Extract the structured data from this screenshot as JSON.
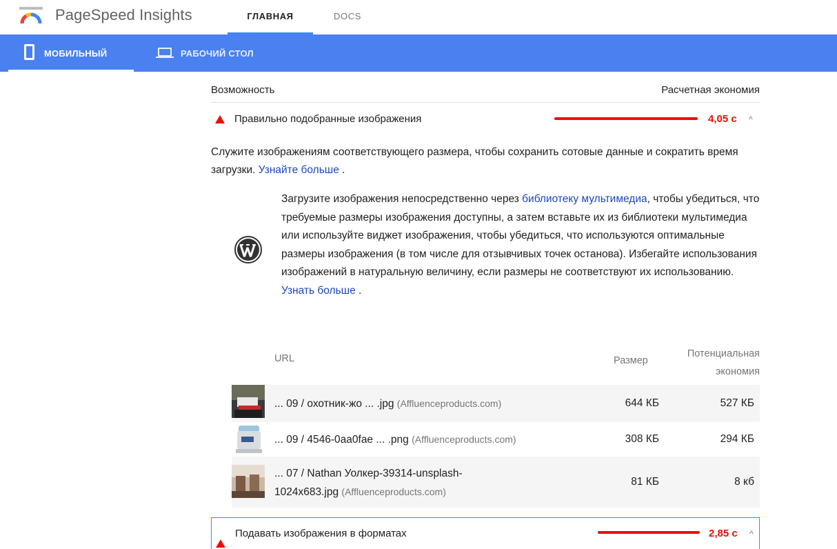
{
  "header": {
    "brand": "PageSpeed Insights",
    "tabs": [
      {
        "label": "ГЛАВНАЯ",
        "active": true
      },
      {
        "label": "DOCS",
        "active": false
      }
    ]
  },
  "device_tabs": [
    {
      "label": "МОБИЛЬНЫЙ",
      "icon": "smartphone-icon",
      "active": true
    },
    {
      "label": "РАБОЧИЙ СТОЛ",
      "icon": "laptop-icon",
      "active": false
    }
  ],
  "columns": {
    "opportunity": "Возможность",
    "savings": "Расчетная экономия"
  },
  "audits": [
    {
      "title": "Правильно подобранные изображения",
      "savings": "4,05 с",
      "expanded": true,
      "description": "Служите изображениям соответствующего размера, чтобы сохранить сотовые данные и сократить время загрузки.",
      "learn_more": "Узнайте больше",
      "stack_pack": {
        "text_before": "Загрузите изображения непосредственно через ",
        "link": "библиотеку мультимедиа",
        "text_after": ", чтобы убедиться, что требуемые размеры изображения доступны, а затем вставьте их из библиотеки мультимедиа или используйте виджет изображения, чтобы убедиться, что используются оптимальные размеры изображения (в том числе для отзывчивых точек останова). Избегайте использования изображений в натуральную величину, если размеры не соответствуют их использованию.",
        "learn_more": "Узнать больше"
      },
      "table": {
        "headers": {
          "url": "URL",
          "size": "Размер",
          "potential_1": "Потенциальная",
          "potential_2": "экономия"
        },
        "rows": [
          {
            "url": "... 09 / охотник-жо ... .jpg",
            "host": "(Affluenceproducts.com)",
            "size": "644 КБ",
            "savings": "527 КБ"
          },
          {
            "url": "... 09 / 4546-0aa0fae ... .png",
            "host": "(Affluenceproducts.com)",
            "size": "308 КБ",
            "savings": "294 КБ"
          },
          {
            "url_line1": "... 07 / Nathan Уолкер-39314-unsplash-",
            "url_line2": "1024x683.jpg",
            "host": "(Affluenceproducts.com)",
            "size": "81 КБ",
            "savings": "8 кб"
          }
        ]
      }
    },
    {
      "title": "Подавать изображения в форматах",
      "savings": "2,85 с",
      "expanded": false
    }
  ],
  "colors": {
    "accent_blue": "#4a80f0",
    "fail_red": "#eb0f00",
    "link_blue": "#1a47b8"
  }
}
